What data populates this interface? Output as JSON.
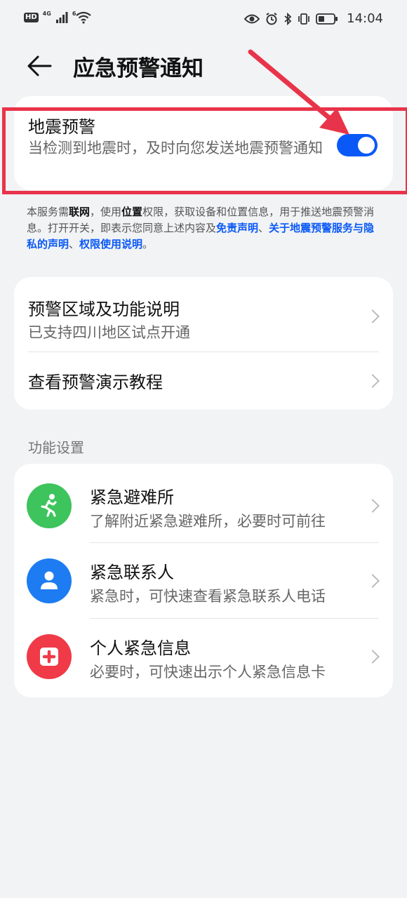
{
  "status_bar": {
    "hd": "HD",
    "network": "4G",
    "wifi_badge": "6",
    "time": "14:04",
    "icons": [
      "signal-icon",
      "wifi-icon",
      "eye-icon",
      "alarm-icon",
      "bluetooth-icon",
      "vibrate-icon",
      "battery-icon"
    ]
  },
  "header": {
    "title": "应急预警通知"
  },
  "quake": {
    "title": "地震预警",
    "desc": "当检测到地震时，及时向您发送地震预警通知",
    "enabled": true
  },
  "notice": {
    "t1": "本服务需",
    "b1": "联网",
    "t2": "，使用",
    "b2": "位置",
    "t3": "权限，获取设备和位置信息，用于推送地震预警消息。打开开关，即表示您同意上述内容及",
    "l1": "免责声明",
    "t4": "、",
    "l2": "关于地震预警服务与隐私的声明",
    "t5": "、",
    "l3": "权限使用说明",
    "t6": "。"
  },
  "warn_card": {
    "area_title": "预警区域及功能说明",
    "area_sub": "已支持四川地区试点开通",
    "demo_title": "查看预警演示教程"
  },
  "section": {
    "label": "功能设置"
  },
  "functions": [
    {
      "title": "紧急避难所",
      "sub": "了解附近紧急避难所，必要时可前往",
      "color": "#3dc45c"
    },
    {
      "title": "紧急联系人",
      "sub": "紧急时，可快速查看紧急联系人电话",
      "color": "#1d7cf2"
    },
    {
      "title": "个人紧急信息",
      "sub": "必要时，可快速出示个人紧急信息卡",
      "color": "#f03a47"
    }
  ],
  "colors": {
    "accent": "#0a59f7",
    "highlight": "#e8344a",
    "background": "#f1f3f5"
  }
}
